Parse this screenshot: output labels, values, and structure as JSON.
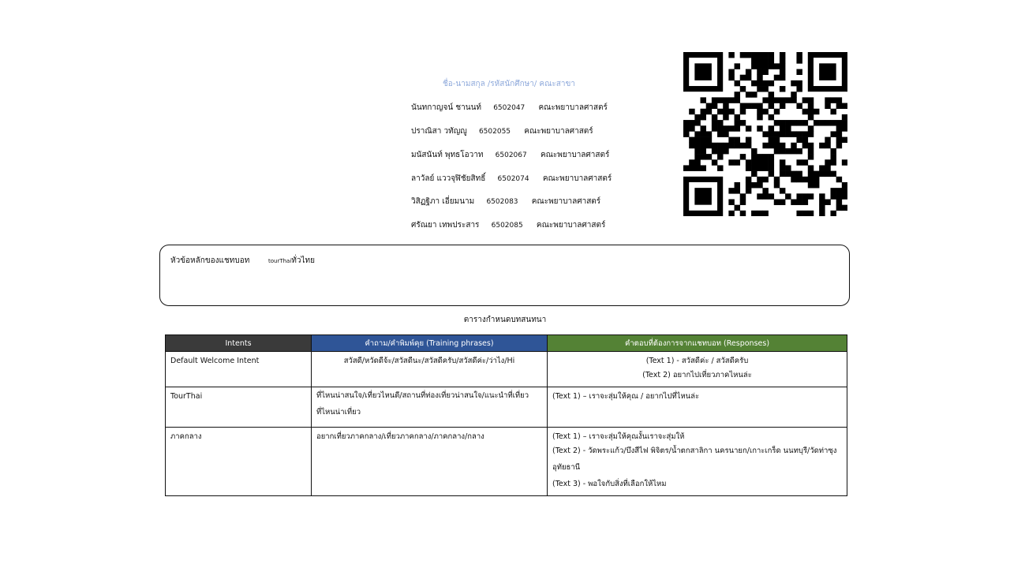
{
  "members": {
    "header": "ชื่อ-นามสกุล /รหัสนักศึกษา/ คณะสาขา",
    "rows": [
      {
        "name": "นันทกาญจน์ ชานนท์",
        "id": "6502047",
        "faculty": "คณะพยาบาลศาสตร์"
      },
      {
        "name": "ปราณิสา วทัญญู",
        "id": "6502055",
        "faculty": "คณะพยาบาลศาสตร์"
      },
      {
        "name": "มนัสนันท์ พุทธโอวาท",
        "id": "6502067",
        "faculty": "คณะพยาบาลศาสตร์"
      },
      {
        "name": "ลาวัลย์ แววจุฬิชัยสิทธิ์",
        "id": "6502074",
        "faculty": "คณะพยาบาลศาสตร์"
      },
      {
        "name": "วิสิฏฐิภา เอี่ยมนาม",
        "id": "6502083",
        "faculty": "คณะพยาบาลศาสตร์"
      },
      {
        "name": "ศรัณยา เทพประสาร",
        "id": "6502085",
        "faculty": "คณะพยาบาลศาสตร์"
      }
    ]
  },
  "topic": {
    "label": "หัวข้อหลักของแชทบอท",
    "value_small": "tourThai",
    "value": "ทั่วไทย"
  },
  "table_title": "ตารางกำหนดบทสนทนา",
  "table": {
    "headers": [
      "Intents",
      "คำถาม/คำพิมพ์คุย (Training phrases)",
      "คำตอบที่ต้องการจากแชทบอท (Responses)"
    ],
    "rows": [
      {
        "intent": "Default Welcome Intent",
        "phrases": "สวัสดี/หวัดดีจ้ะ/สวัสดีนะ/สวัสดีครับ/สวัสดีค่ะ/ว่าไง/Hi",
        "responses": [
          "(Text 1) - สวัสดีค่ะ / สวัสดีครับ",
          "(Text 2) อยากไปเที่ยวภาคไหนล่ะ"
        ]
      },
      {
        "intent": "TourThai",
        "phrases": "ที่ไหนน่าสนใจ/เที่ยวไหนดี/สถานที่ท่องเที่ยวน่าสนใจ/แนะนำที่เที่ยวที่ไหนน่าเที่ยว",
        "responses": [
          "(Text 1) – เราจะสุ่มให้คุณ / อยากไปที่ไหนล่ะ"
        ]
      },
      {
        "intent": "ภาคกลาง",
        "phrases": "อยากเที่ยวภาคกลาง/เที่ยวภาคกลาง/ภาคกลาง/กลาง",
        "responses": [
          "(Text 1) – เราจะสุ่มให้คุณงั้นเราจะสุ่มให้",
          "(Text 2) - วัดพระแก้ว/บึงสีไฟ พิจิตร/น้ำตกสาลิกา นครนายก/เกาะเกร็ด นนทบุรี/วัดท่าซุงอุทัยธานี",
          "(Text 3) - พอใจกับสิ่งที่เลือกให้ไหม"
        ]
      }
    ]
  },
  "colors": {
    "header_intents": "#3a3a3a",
    "header_phrases": "#2f5597",
    "header_responses": "#548235",
    "members_header": "#8ea9db"
  },
  "qr_icon": "qr-code-icon"
}
